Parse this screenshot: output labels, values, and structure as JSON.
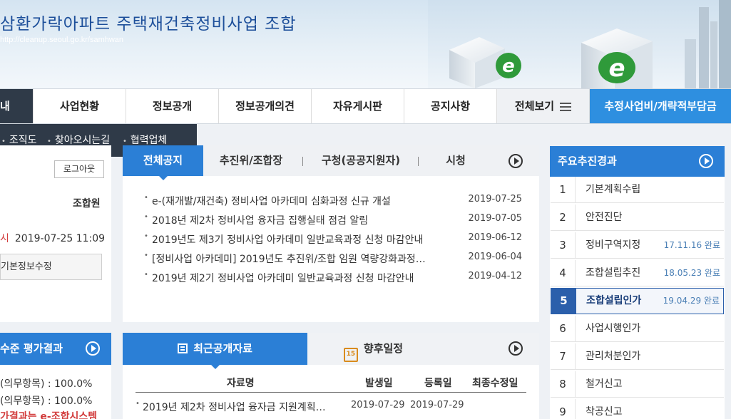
{
  "header": {
    "site_title": "삼환가락아파트 주택재건축정비사업 조합",
    "site_url": "http://cleanup.seoul.go.kr/samhwan",
    "deco_letter": "e"
  },
  "gnb": {
    "items": [
      {
        "label": "내"
      },
      {
        "label": "사업현황"
      },
      {
        "label": "정보공개"
      },
      {
        "label": "정보공개의견"
      },
      {
        "label": "자유게시판"
      },
      {
        "label": "공지사항"
      },
      {
        "label": "전체보기"
      },
      {
        "label": "추정사업비/개략적부담금"
      }
    ]
  },
  "subnav": {
    "items": [
      {
        "label": "조직도"
      },
      {
        "label": "찾아오시는길"
      },
      {
        "label": "협력업체"
      }
    ]
  },
  "user": {
    "logout_label": "로그아웃",
    "member_label": "조합원",
    "last_login_mark": "시",
    "last_login": "2019-07-25 11:09",
    "edit_label": "기본정보수정"
  },
  "news": {
    "tabs": [
      {
        "label": "전체공지"
      },
      {
        "label": "추진위/조합장"
      },
      {
        "label": "구청(공공지원자)"
      },
      {
        "label": "시청"
      }
    ],
    "items": [
      {
        "title": "e-(재개발/재건축) 정비사업 아카데미 심화과정 신규 개설",
        "date": "2019-07-25"
      },
      {
        "title": "2018년 제2차 정비사업 융자금 집행실태 점검 알림",
        "date": "2019-07-05"
      },
      {
        "title": "2019년도 제3기 정비사업 아카데미 일반교육과정 신청 마감안내",
        "date": "2019-06-12"
      },
      {
        "title": "[정비사업 아카데미] 2019년도 추진위/조합 임원 역량강화과정…",
        "date": "2019-06-04"
      },
      {
        "title": "2019년 제2기 정비사업 아카데미 일반교육과정 신청 마감안내",
        "date": "2019-04-12"
      }
    ]
  },
  "level": {
    "title": "수준 평가결과",
    "lines": [
      "(의무항목) : 100.0%",
      "(의무항목) : 100.0%",
      "가결과는 e-조합시스템"
    ]
  },
  "data_tabs": {
    "recent_label": "최근공개자료",
    "schedule_label": "향후일정",
    "calendar_number": "15",
    "columns": [
      "자료명",
      "발생일",
      "등록일",
      "최종수정일"
    ],
    "rows": [
      {
        "title": "2019년 제2차 정비사업 융자금 지원계획…",
        "occurred": "2019-07-29",
        "registered": "2019-07-29",
        "modified": ""
      }
    ]
  },
  "progress": {
    "title": "주요추진경과",
    "steps": [
      {
        "num": "1",
        "name": "기본계획수립",
        "date": ""
      },
      {
        "num": "2",
        "name": "안전진단",
        "date": ""
      },
      {
        "num": "3",
        "name": "정비구역지정",
        "date": "17.11.16 완료"
      },
      {
        "num": "4",
        "name": "조합설립추진",
        "date": "18.05.23 완료"
      },
      {
        "num": "5",
        "name": "조합설립인가",
        "date": "19.04.29 완료"
      },
      {
        "num": "6",
        "name": "사업시행인가",
        "date": ""
      },
      {
        "num": "7",
        "name": "관리처분인가",
        "date": ""
      },
      {
        "num": "8",
        "name": "철거신고",
        "date": ""
      },
      {
        "num": "9",
        "name": "착공신고",
        "date": ""
      }
    ],
    "current_index": 4
  },
  "colors": {
    "accent_blue": "#2b7fd6",
    "gnb_dark": "#2f3a48",
    "gnb_blue": "#2e8fe0",
    "current_step": "#2b5fab",
    "alert_red": "#d23c3c"
  },
  "icons": [
    "play-circle-icon",
    "hamburger-icon",
    "document-icon",
    "calendar-icon",
    "bullet-icon",
    "e-logo-icon"
  ]
}
